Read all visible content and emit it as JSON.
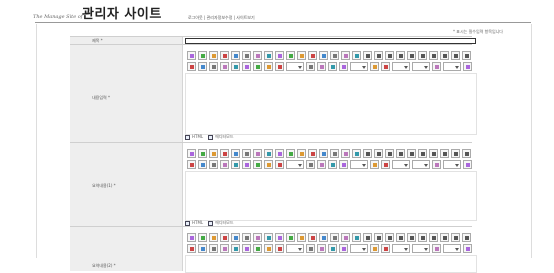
{
  "header": {
    "title": "관리자 사이트",
    "subtitle": "The Manage Site of",
    "nav_text": "로그아웃 | 관리자정보수정 | 사이트보기"
  },
  "form": {
    "required_note": "* 표시는 필수입력 항목입니다",
    "rows": [
      {
        "label": "제목 *"
      },
      {
        "label": "내용입력 *"
      },
      {
        "label": "요약내용(1) *"
      },
      {
        "label": "요약내용(2) *"
      }
    ],
    "mode_labels": {
      "html": "HTML",
      "editor": "에디터모드"
    }
  },
  "toolbar_palette": [
    "#a6d",
    "#4a4",
    "#d93",
    "#c44",
    "#48c",
    "#777",
    "#b7b",
    "#39a"
  ]
}
